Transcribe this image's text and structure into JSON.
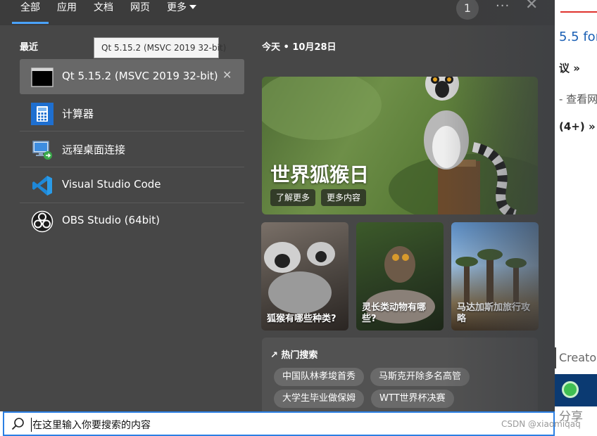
{
  "nav": {
    "tabs": [
      {
        "label": "全部"
      },
      {
        "label": "应用"
      },
      {
        "label": "文档"
      },
      {
        "label": "网页"
      },
      {
        "label": "更多"
      }
    ],
    "notification_count": "1",
    "more_glyph": "···",
    "close_glyph": "✕"
  },
  "recent": {
    "section_label": "最近",
    "tooltip": "Qt 5.15.2 (MSVC 2019 32-bit)",
    "items": [
      {
        "label": "Qt 5.15.2 (MSVC 2019 32-bit)",
        "icon": "qt-console-icon"
      },
      {
        "label": "计算器",
        "icon": "calculator-icon"
      },
      {
        "label": "远程桌面连接",
        "icon": "remote-desktop-icon"
      },
      {
        "label": "Visual Studio Code",
        "icon": "vscode-icon"
      },
      {
        "label": "OBS Studio (64bit)",
        "icon": "obs-icon"
      }
    ],
    "remove_glyph": "✕"
  },
  "today": {
    "date_label": "今天 • 10月28日",
    "hero": {
      "title": "世界狐猴日",
      "buttons": [
        "了解更多",
        "更多内容"
      ]
    },
    "cards": [
      {
        "title": "狐猴有哪些种类?"
      },
      {
        "title": "灵长类动物有哪些?"
      },
      {
        "title": "马达加斯加旅行攻略"
      }
    ]
  },
  "trending": {
    "title": "↗ 热门搜索",
    "tags": [
      "中国队林孝埈首秀",
      "马斯克开除多名高管",
      "大学生毕业做保姆",
      "WTT世界杯决赛"
    ]
  },
  "search": {
    "placeholder": "在这里输入你要搜索的内容"
  },
  "background_page": {
    "lines": [
      "5.5 for",
      "议 »",
      "- 查看网",
      "(4+) »",
      "Creato",
      "分享"
    ]
  },
  "watermark": "CSDN @xiaomiqaq",
  "colors": {
    "panel_bg": "#474747",
    "accent": "#4aa3ff",
    "search_border": "#2b7fe3"
  }
}
